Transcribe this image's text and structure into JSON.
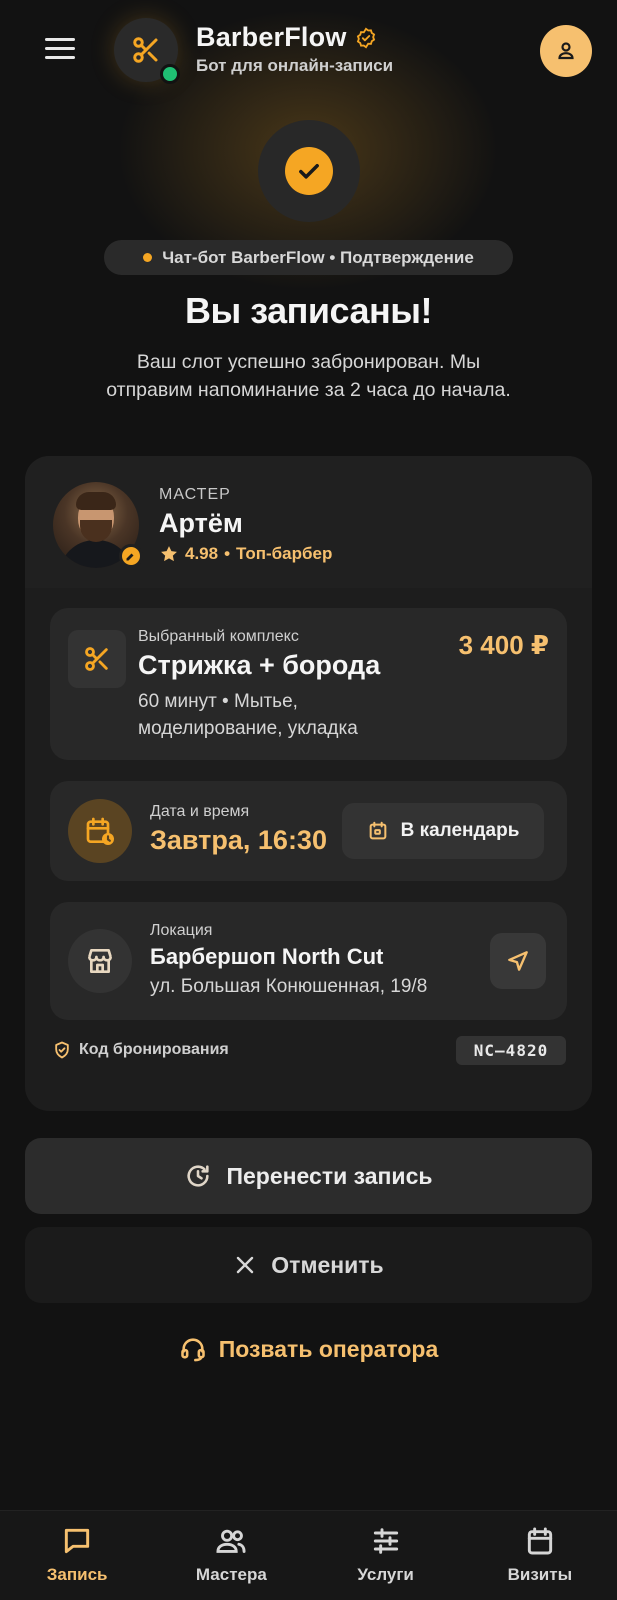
{
  "header": {
    "brand_name": "BarberFlow",
    "brand_sub": "Бот для онлайн-записи",
    "menu_icon": "hamburger-menu-icon",
    "logo_icon": "scissors-icon",
    "verified_icon": "verified-badge-icon",
    "profile_icon": "user-icon",
    "status": "online"
  },
  "confirmation": {
    "icon": "check-circle-icon",
    "pill_text": "Чат-бот BarberFlow • Подтверждение",
    "title": "Вы записаны!",
    "subtitle": "Ваш слот успешно забронирован. Мы отправим напоминание за 2 часа до начала."
  },
  "master": {
    "label": "МАСТЕР",
    "name": "Артём",
    "rating": "4.98",
    "rating_sep": "•",
    "rank": "Топ-барбер"
  },
  "service": {
    "label": "Выбранный комплекс",
    "name": "Стрижка + борода",
    "description": "60 минут • Мытье, моделирование, укладка",
    "price": "3 400 ₽"
  },
  "datetime": {
    "label": "Дата и время",
    "value": "Завтра, 16:30",
    "calendar_button": "В календарь"
  },
  "location": {
    "label": "Локация",
    "name": "Барбершоп North Cut",
    "address": "ул. Большая Конюшенная, 19/8"
  },
  "booking": {
    "code_label": "Код бронирования",
    "code": "NC–4820"
  },
  "actions": {
    "reschedule": "Перенести запись",
    "cancel": "Отменить",
    "operator": "Позвать оператора"
  },
  "bottom_nav": {
    "items": [
      {
        "label": "Запись",
        "icon": "chat-icon",
        "active": true
      },
      {
        "label": "Мастера",
        "icon": "users-icon",
        "active": false
      },
      {
        "label": "Услуги",
        "icon": "sliders-icon",
        "active": false
      },
      {
        "label": "Визиты",
        "icon": "calendar-icon",
        "active": false
      }
    ]
  },
  "colors": {
    "accent": "#f5a623",
    "accent_light": "#f6c06f",
    "background": "#121212",
    "online": "#1fbf74"
  }
}
